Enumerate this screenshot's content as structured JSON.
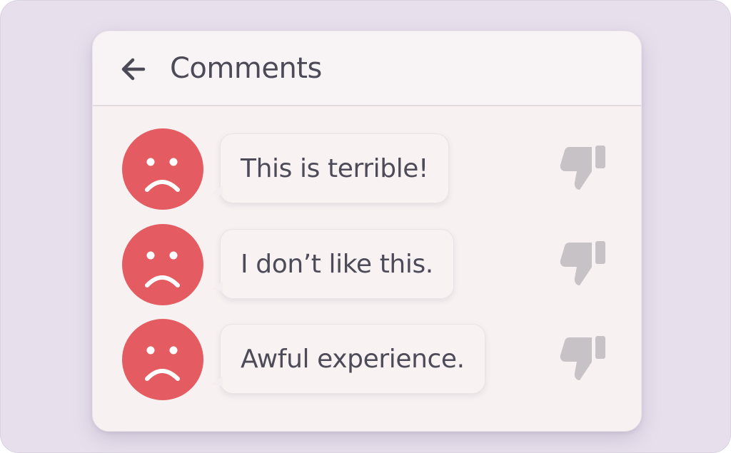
{
  "header": {
    "back_icon": "arrow-left-icon",
    "title": "Comments"
  },
  "comments": [
    {
      "avatar_icon": "sad-face-icon",
      "text": "This is terrible!",
      "action_icon": "thumbs-down-icon"
    },
    {
      "avatar_icon": "sad-face-icon",
      "text": "I don’t like this.",
      "action_icon": "thumbs-down-icon"
    },
    {
      "avatar_icon": "sad-face-icon",
      "text": "Awful experience.",
      "action_icon": "thumbs-down-icon"
    }
  ],
  "colors": {
    "background": "#e7e0ec",
    "card": "#f7f1f2",
    "avatar": "#e45c61",
    "text": "#4d4b57",
    "thumb_icon": "#c7c2c6"
  }
}
